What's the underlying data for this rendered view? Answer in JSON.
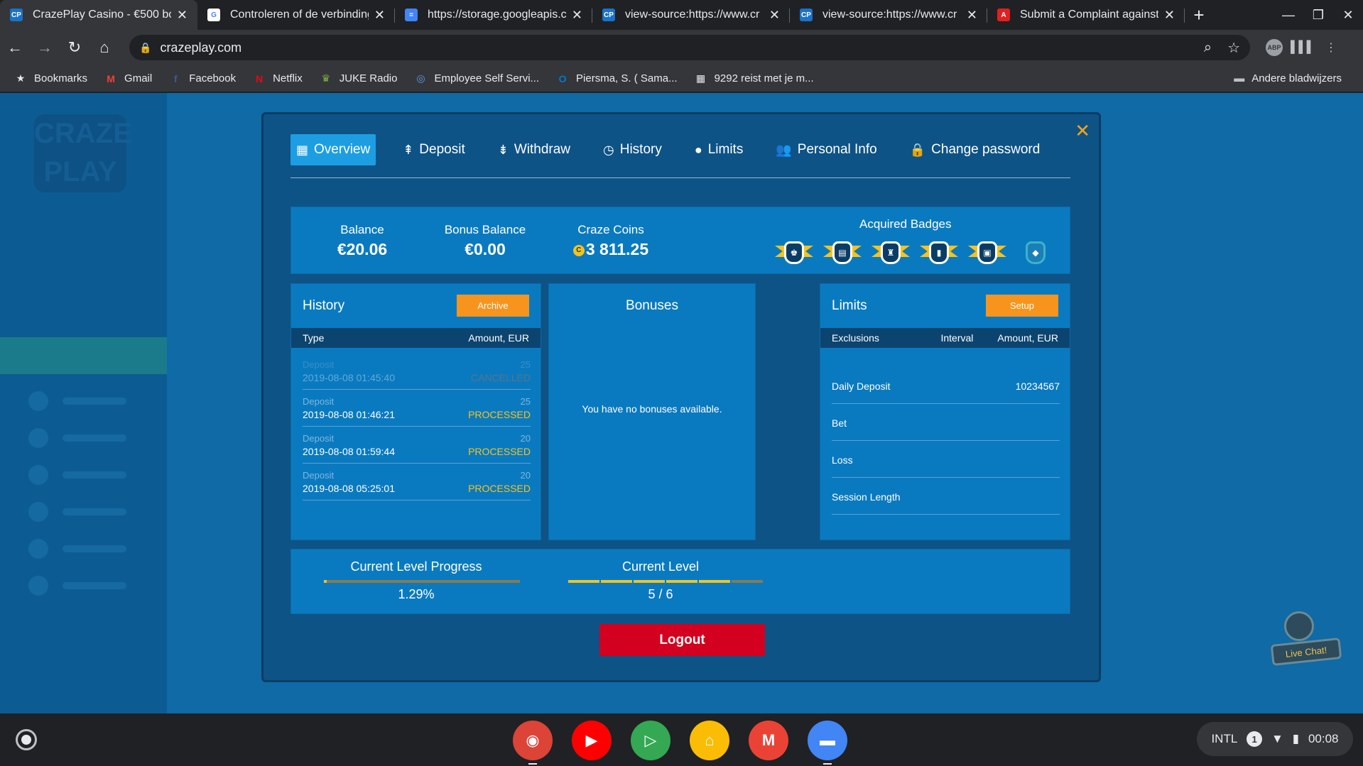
{
  "browser": {
    "tabs": [
      {
        "title": "CrazePlay Casino - €500 bon",
        "icon_color": "#1a73c8",
        "icon_text": "CP",
        "active": true
      },
      {
        "title": "Controleren of de verbinding",
        "icon_color": "#ffffff",
        "icon_text": "G",
        "active": false
      },
      {
        "title": "https://storage.googleapis.c",
        "icon_color": "#4285f4",
        "icon_text": "=",
        "active": false
      },
      {
        "title": "view-source:https://www.cr",
        "icon_color": "#1a73c8",
        "icon_text": "CP",
        "active": false
      },
      {
        "title": "view-source:https://www.cr",
        "icon_color": "#1a73c8",
        "icon_text": "CP",
        "active": false
      },
      {
        "title": "Submit a Complaint against",
        "icon_color": "#e02020",
        "icon_text": "A",
        "active": false
      }
    ],
    "url": "crazeplay.com",
    "bookmarks": [
      {
        "label": "Bookmarks",
        "icon": "★",
        "color": "#e8eaed"
      },
      {
        "label": "Gmail",
        "icon": "M",
        "color": "#ea4335"
      },
      {
        "label": "Facebook",
        "icon": "f",
        "color": "#3b5998"
      },
      {
        "label": "Netflix",
        "icon": "N",
        "color": "#e50914"
      },
      {
        "label": "JUKE Radio",
        "icon": "♛",
        "color": "#7cb342"
      },
      {
        "label": "Employee Self Servi...",
        "icon": "◎",
        "color": "#5c9ded"
      },
      {
        "label": "Piersma, S. ( Sama...",
        "icon": "O",
        "color": "#0078d4"
      },
      {
        "label": "9292 reist met je m...",
        "icon": "▦",
        "color": "#e8eaed"
      }
    ],
    "other_bookmarks": "Andere bladwijzers"
  },
  "modal": {
    "tabs": [
      {
        "label": "Overview",
        "icon": "▦",
        "active": true
      },
      {
        "label": "Deposit",
        "icon": "⇞",
        "active": false
      },
      {
        "label": "Withdraw",
        "icon": "⇟",
        "active": false
      },
      {
        "label": "History",
        "icon": "◷",
        "active": false
      },
      {
        "label": "Limits",
        "icon": "●",
        "active": false
      },
      {
        "label": "Personal Info",
        "icon": "👥",
        "active": false
      },
      {
        "label": "Change password",
        "icon": "🔒",
        "active": false
      }
    ],
    "summary": {
      "balance_label": "Balance",
      "balance_value": "€20.06",
      "bonus_label": "Bonus Balance",
      "bonus_value": "€0.00",
      "coins_label": "Craze Coins",
      "coins_value": "3 811.25",
      "badges_label": "Acquired Badges",
      "badges": [
        {
          "icon": "♚",
          "acquired": true
        },
        {
          "icon": "▤",
          "acquired": true
        },
        {
          "icon": "♜",
          "acquired": true
        },
        {
          "icon": "▮",
          "acquired": true
        },
        {
          "icon": "▣",
          "acquired": true
        },
        {
          "icon": "◆",
          "acquired": false
        }
      ]
    },
    "history": {
      "title": "History",
      "archive_label": "Archive",
      "col_type": "Type",
      "col_amount": "Amount, EUR",
      "rows": [
        {
          "type": "Deposit",
          "date": "2019-08-08 01:45:40",
          "amount": "25",
          "status": "CANCELLED"
        },
        {
          "type": "Deposit",
          "date": "2019-08-08 01:46:21",
          "amount": "25",
          "status": "PROCESSED"
        },
        {
          "type": "Deposit",
          "date": "2019-08-08 01:59:44",
          "amount": "20",
          "status": "PROCESSED"
        },
        {
          "type": "Deposit",
          "date": "2019-08-08 05:25:01",
          "amount": "20",
          "status": "PROCESSED"
        }
      ]
    },
    "bonuses": {
      "title": "Bonuses",
      "empty_text": "You have no bonuses available."
    },
    "limits": {
      "title": "Limits",
      "setup_label": "Setup",
      "col_exclusions": "Exclusions",
      "col_interval": "Interval",
      "col_amount": "Amount, EUR",
      "rows": [
        {
          "name": "Daily Deposit",
          "value": "10234567"
        },
        {
          "name": "Bet",
          "value": ""
        },
        {
          "name": "Loss",
          "value": ""
        },
        {
          "name": "Session Length",
          "value": ""
        }
      ]
    },
    "progress": {
      "progress_label": "Current Level Progress",
      "progress_value": "1.29%",
      "progress_fraction": 0.0129,
      "level_label": "Current Level",
      "level_value": "5 / 6",
      "level_current": 5,
      "level_total": 6
    },
    "logout_label": "Logout"
  },
  "livechat_label": "Live Chat!",
  "shelf": {
    "apps": [
      {
        "name": "chrome-icon",
        "glyph": "◉",
        "color": "#db4437"
      },
      {
        "name": "youtube-icon",
        "glyph": "▶",
        "color": "#ff0000"
      },
      {
        "name": "play-store-icon",
        "glyph": "▷",
        "color": "#34a853"
      },
      {
        "name": "google-home-icon",
        "glyph": "⌂",
        "color": "#fbbc05"
      },
      {
        "name": "gmail-icon",
        "glyph": "M",
        "color": "#ea4335"
      },
      {
        "name": "files-icon",
        "glyph": "▬",
        "color": "#4285f4"
      }
    ],
    "keyboard": "INTL",
    "notifications": "1",
    "time": "00:08"
  }
}
